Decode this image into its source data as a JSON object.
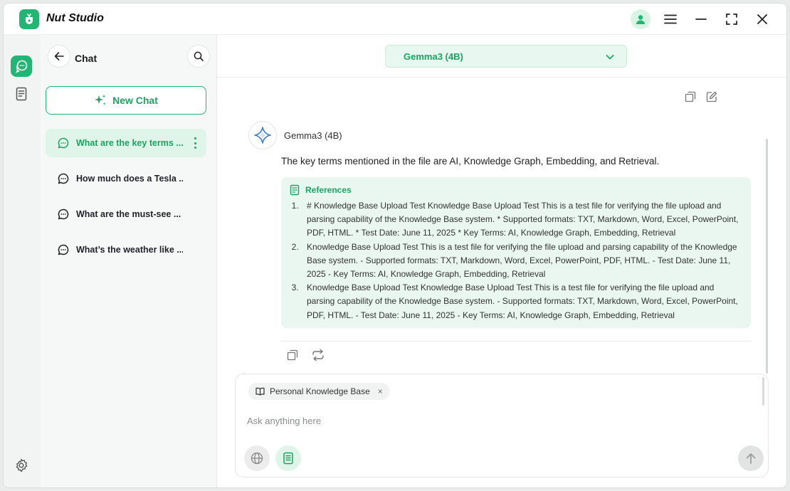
{
  "app": {
    "title": "Nut Studio"
  },
  "panel": {
    "title": "Chat",
    "new_chat_label": "New Chat",
    "chats": [
      {
        "label": "What are the key terms ..."
      },
      {
        "label": "How much does a Tesla ..."
      },
      {
        "label": "What are the must-see ..."
      },
      {
        "label": "What’s the weather like ..."
      }
    ]
  },
  "main": {
    "model_label": "Gemma3 (4B)",
    "bot_name": "Gemma3 (4B)",
    "answer": "The key terms mentioned in the file are AI, Knowledge Graph, Embedding, and Retrieval.",
    "references": {
      "title": "References",
      "items": [
        "# Knowledge Base Upload Test Knowledge Base Upload Test This is a test file for verifying the file upload and parsing capability of the Knowledge Base system. * Supported formats: TXT, Markdown, Word, Excel, PowerPoint, PDF, HTML. * Test Date: June 11, 2025 * Key Terms: AI, Knowledge Graph, Embedding, Retrieval",
        "Knowledge Base Upload Test This is a test file for verifying the file upload and parsing capability of the Knowledge Base system. - Supported formats: TXT, Markdown, Word, Excel, PowerPoint, PDF, HTML. - Test Date: June 11, 2025 - Key Terms: AI, Knowledge Graph, Embedding, Retrieval",
        "Knowledge Base Upload Test Knowledge Base Upload Test This is a test file for verifying the file upload and parsing capability of the Knowledge Base system. - Supported formats: TXT, Markdown, Word, Excel, PowerPoint, PDF, HTML. - Test Date: June 11, 2025 - Key Terms: AI, Knowledge Graph, Embedding, Retrieval"
      ]
    }
  },
  "composer": {
    "chip_label": "Personal Knowledge Base",
    "chip_close": "×",
    "placeholder": "Ask anything here"
  },
  "colors": {
    "accent": "#22b573",
    "accent_text": "#1aa463",
    "accent_bg": "#dff5ea",
    "refs_bg": "#eaf7f0"
  },
  "icons": [
    "app-logo-icon",
    "user-icon",
    "menu-icon",
    "minimize-icon",
    "maximize-icon",
    "close-icon",
    "chat-bubbles-icon",
    "knowledge-base-icon",
    "settings-icon",
    "back-arrow-icon",
    "search-icon",
    "sparkle-icon",
    "chat-bubble-icon",
    "more-vertical-icon",
    "chevron-down-icon",
    "copy-icon",
    "edit-icon",
    "gemma-sparkle-icon",
    "document-icon",
    "regenerate-icon",
    "book-icon",
    "globe-icon",
    "send-arrow-icon"
  ]
}
